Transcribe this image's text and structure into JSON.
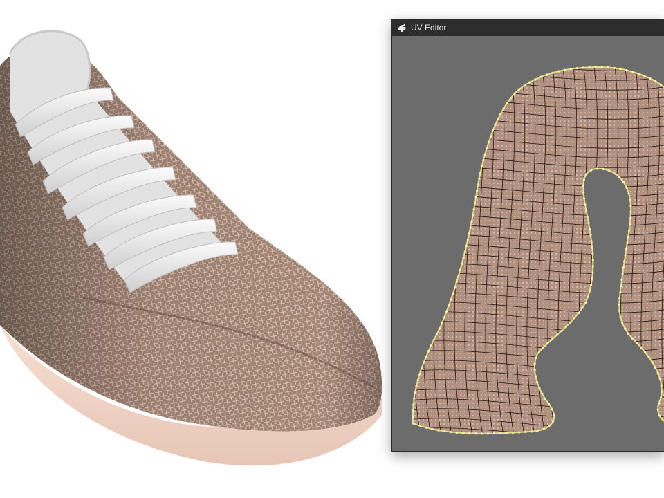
{
  "uv_editor": {
    "title": "UV Editor",
    "logo_icon": "rhino-icon"
  },
  "viewport": {
    "object": "sneaker-model",
    "upper_texture": "diamond-mesh-fabric",
    "colors": {
      "fabric": "#a48574",
      "fabric_dark": "#6f5446",
      "lace": "#eeeeee",
      "sole": "#f1d8cc"
    }
  },
  "colors": {
    "uv_background": "#6c6c6c",
    "titlebar": "#2d2d2d",
    "uv_fill": "#b29181",
    "uv_grid": "#1e1410",
    "uv_border": "#e6e07a",
    "uv_vertex": "#f2eebc"
  }
}
